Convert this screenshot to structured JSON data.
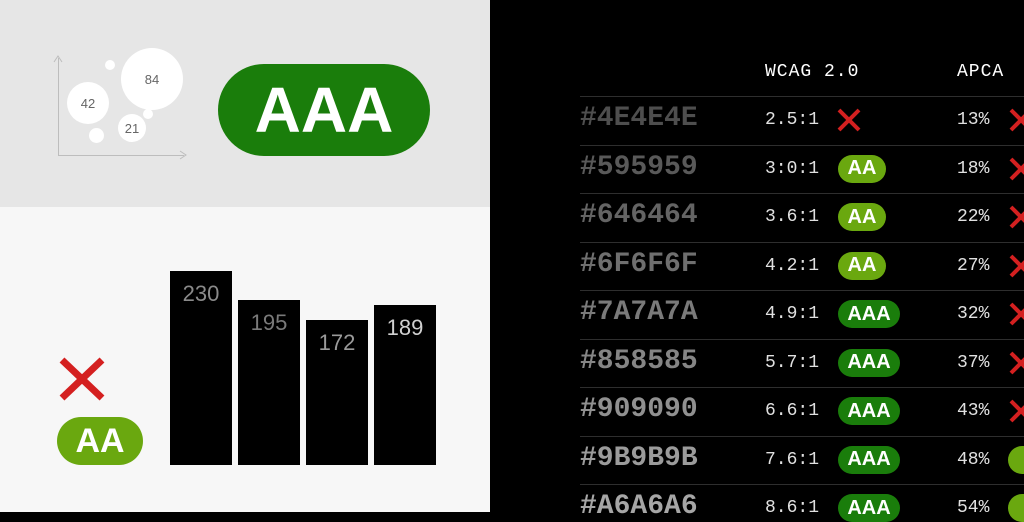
{
  "bubbles": [
    "42",
    "84",
    "21"
  ],
  "big_badge": "AAA",
  "small_badge": "AA",
  "bars": [
    {
      "label": "230",
      "label_color": "#8a8a8a"
    },
    {
      "label": "195",
      "label_color": "#7a7a7a"
    },
    {
      "label": "172",
      "label_color": "#9a9a9a"
    },
    {
      "label": "189",
      "label_color": "#d0d0d0"
    }
  ],
  "table": {
    "headers": {
      "wcag": "WCAG 2.0",
      "apca": "APCA"
    },
    "rows": [
      {
        "hex": "#4E4E4E",
        "ratio": "2.5:1",
        "wcag": "",
        "apca": "13%",
        "apca_ok": false
      },
      {
        "hex": "#595959",
        "ratio": "3:0:1",
        "wcag": "AA",
        "apca": "18%",
        "apca_ok": false
      },
      {
        "hex": "#646464",
        "ratio": "3.6:1",
        "wcag": "AA",
        "apca": "22%",
        "apca_ok": false
      },
      {
        "hex": "#6F6F6F",
        "ratio": "4.2:1",
        "wcag": "AA",
        "apca": "27%",
        "apca_ok": false
      },
      {
        "hex": "#7A7A7A",
        "ratio": "4.9:1",
        "wcag": "AAA",
        "apca": "32%",
        "apca_ok": false
      },
      {
        "hex": "#858585",
        "ratio": "5.7:1",
        "wcag": "AAA",
        "apca": "37%",
        "apca_ok": false
      },
      {
        "hex": "#909090",
        "ratio": "6.6:1",
        "wcag": "AAA",
        "apca": "43%",
        "apca_ok": false
      },
      {
        "hex": "#9B9B9B",
        "ratio": "7.6:1",
        "wcag": "AAA",
        "apca": "48%",
        "apca_ok": true
      },
      {
        "hex": "#A6A6A6",
        "ratio": "8.6:1",
        "wcag": "AAA",
        "apca": "54%",
        "apca_ok": true
      }
    ]
  },
  "colors": {
    "aa_green": "#6aa80f",
    "aaa_green": "#1a7d0b",
    "fail_red": "#d42020"
  }
}
